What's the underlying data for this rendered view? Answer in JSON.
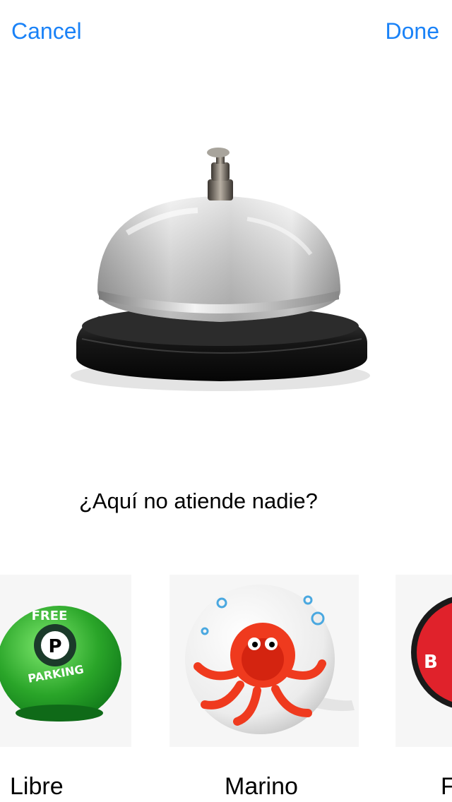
{
  "nav": {
    "cancel_label": "Cancel",
    "done_label": "Done"
  },
  "hero": {
    "image": "silver service desk bell",
    "caption": "¿Aquí no atiende nadie?"
  },
  "carousel": {
    "items": [
      {
        "label": "Libre",
        "image": "green free parking ball"
      },
      {
        "label": "Marino",
        "image": "white bike bell with red octopus"
      },
      {
        "label": "F",
        "image": "red button bell"
      }
    ]
  },
  "colors": {
    "accent": "#1a82f7",
    "background": "#ffffff"
  }
}
